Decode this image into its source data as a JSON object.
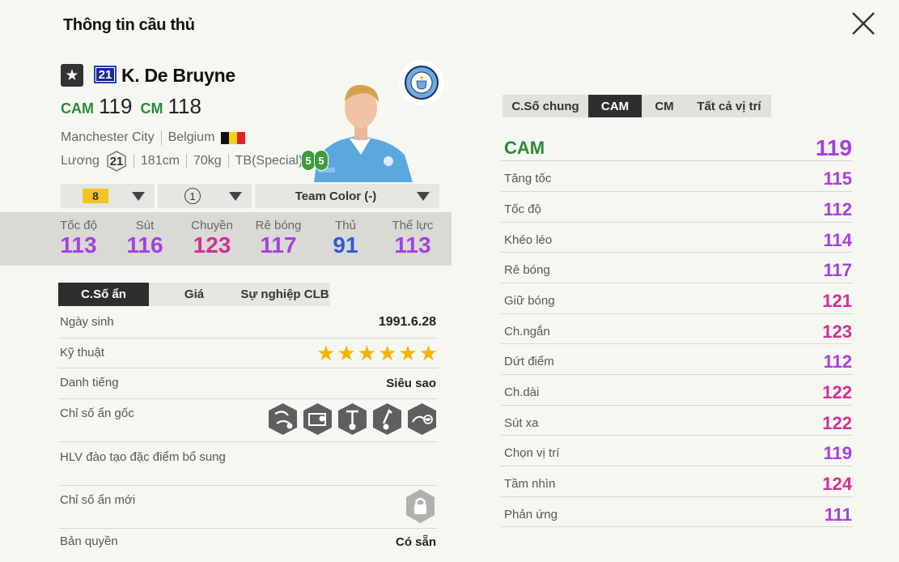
{
  "page": {
    "title": "Thông tin cầu thủ"
  },
  "icons": {
    "close": "close-icon",
    "star": "star-icon",
    "club": "manchester-city-crest-icon"
  },
  "player": {
    "season_number": "21",
    "name": "K. De Bruyne",
    "positions": [
      {
        "label": "CAM",
        "value": "119"
      },
      {
        "label": "CM",
        "value": "118"
      }
    ],
    "club": "Manchester City",
    "nation": "Belgium",
    "salary_label": "Lương",
    "salary": "21",
    "height": "181cm",
    "weight": "70kg",
    "body_type": "TB(Special)",
    "skill_moves": "5",
    "weak_foot": "5"
  },
  "selectors": {
    "upgrade_level": "8",
    "team_level": "1",
    "team_color": "Team Color (-)"
  },
  "summary_stats": [
    {
      "label": "Tốc độ",
      "value": "113",
      "color": "#a63fe0"
    },
    {
      "label": "Sút",
      "value": "116",
      "color": "#a63fe0"
    },
    {
      "label": "Chuyền",
      "value": "123",
      "color": "#d0309a"
    },
    {
      "label": "Rê bóng",
      "value": "117",
      "color": "#a63fe0"
    },
    {
      "label": "Thủ",
      "value": "91",
      "color": "#2c5bd6"
    },
    {
      "label": "Thể lực",
      "value": "113",
      "color": "#a63fe0"
    }
  ],
  "left_tabs": [
    "C.Số ẩn",
    "Giá",
    "Sự nghiệp CLB"
  ],
  "details": {
    "birth_label": "Ngày sinh",
    "birth": "1991.6.28",
    "skill_label": "Kỹ thuật",
    "skill_stars": 6,
    "fame_label": "Danh tiếng",
    "fame": "Siêu sao",
    "traits_label": "Chỉ số ẩn gốc",
    "coach_label": "HLV đào tạo đặc điểm bổ sung",
    "new_traits_label": "Chỉ số ẩn mới",
    "license_label": "Bản quyền",
    "license": "Có sẵn"
  },
  "right_tabs": [
    "C.Số chung",
    "CAM",
    "CM",
    "Tất cả vị trí"
  ],
  "right_stats": [
    {
      "label": "CAM",
      "value": "119",
      "color": "#a63fe0"
    },
    {
      "label": "Tăng tốc",
      "value": "115",
      "color": "#a63fe0"
    },
    {
      "label": "Tốc độ",
      "value": "112",
      "color": "#a63fe0"
    },
    {
      "label": "Khéo léo",
      "value": "114",
      "color": "#a63fe0"
    },
    {
      "label": "Rê bóng",
      "value": "117",
      "color": "#a63fe0"
    },
    {
      "label": "Giữ bóng",
      "value": "121",
      "color": "#d0309a"
    },
    {
      "label": "Ch.ngắn",
      "value": "123",
      "color": "#d0309a"
    },
    {
      "label": "Dứt điểm",
      "value": "112",
      "color": "#a63fe0"
    },
    {
      "label": "Ch.dài",
      "value": "122",
      "color": "#d0309a"
    },
    {
      "label": "Sút xa",
      "value": "122",
      "color": "#d0309a"
    },
    {
      "label": "Chọn vị trí",
      "value": "119",
      "color": "#a63fe0"
    },
    {
      "label": "Tầm nhìn",
      "value": "124",
      "color": "#d0309a"
    },
    {
      "label": "Phản ứng",
      "value": "111",
      "color": "#a63fe0"
    }
  ]
}
